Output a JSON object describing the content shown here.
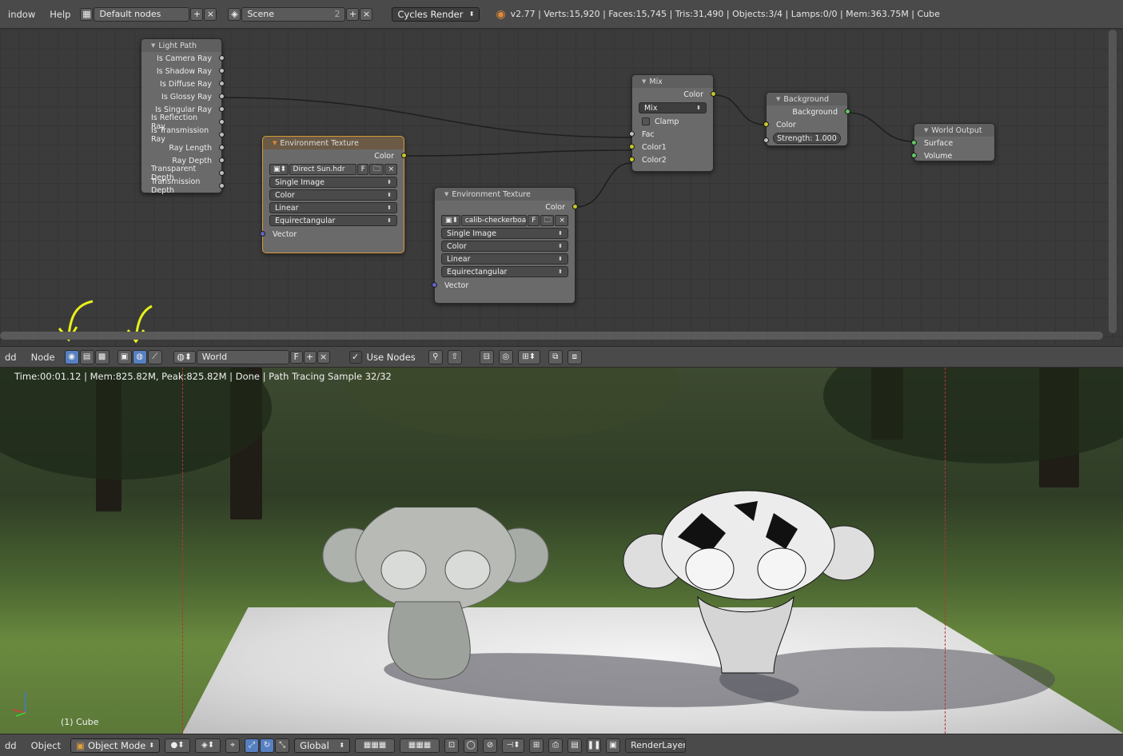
{
  "topbar": {
    "menus": [
      "indow",
      "Help"
    ],
    "screen_layout": "Default nodes",
    "scene": "Scene",
    "scene_users": "2",
    "render_engine": "Cycles Render",
    "stats": "v2.77 | Verts:15,920 | Faces:15,745 | Tris:31,490 | Objects:3/4 | Lamps:0/0 | Mem:363.75M | Cube"
  },
  "nodes": {
    "light_path": {
      "title": "Light Path",
      "outputs": [
        "Is Camera Ray",
        "Is Shadow Ray",
        "Is Diffuse Ray",
        "Is Glossy Ray",
        "Is Singular Ray",
        "Is Reflection Ray",
        "Is Transmission Ray",
        "Ray Length",
        "Ray Depth",
        "Transparent Depth",
        "Transmission Depth"
      ]
    },
    "env_texture_1": {
      "title": "Environment Texture",
      "output": "Color",
      "image": "Direct Sun.hdr",
      "fake_user": "F",
      "source": "Single Image",
      "color_space": "Color",
      "interpolation": "Linear",
      "projection": "Equirectangular",
      "input": "Vector"
    },
    "env_texture_2": {
      "title": "Environment Texture",
      "output": "Color",
      "image": "calib-checkerboard...",
      "fake_user": "F",
      "source": "Single Image",
      "color_space": "Color",
      "interpolation": "Linear",
      "projection": "Equirectangular",
      "input": "Vector"
    },
    "mix": {
      "title": "Mix",
      "output": "Color",
      "blend_type": "Mix",
      "clamp": "Clamp",
      "inputs": [
        "Fac",
        "Color1",
        "Color2"
      ]
    },
    "background": {
      "title": "Background",
      "output": "Background",
      "color": "Color",
      "strength": "Strength:  1.000"
    },
    "world_output": {
      "title": "World Output",
      "inputs": [
        "Surface",
        "Volume"
      ]
    }
  },
  "node_header": {
    "menus": [
      "dd",
      "Node"
    ],
    "world_name": "World",
    "fake_user": "F",
    "use_nodes": "Use Nodes"
  },
  "viewport": {
    "render_info": "Time:00:01.12 | Mem:825.82M, Peak:825.82M | Done | Path Tracing Sample 32/32",
    "object_label": "(1) Cube"
  },
  "bottombar": {
    "menus": [
      "dd",
      "Object"
    ],
    "mode": "Object Mode",
    "orientation": "Global",
    "render_layer": "RenderLayer"
  },
  "colors": {
    "socket_color": "#c7c729",
    "socket_vector": "#6363c7",
    "socket_shader": "#63c763",
    "socket_float": "#bfbfbf",
    "active_node_border": "#d89a3a",
    "annotation_arrow": "#e8f01a",
    "camera_border": "#b3323a"
  }
}
